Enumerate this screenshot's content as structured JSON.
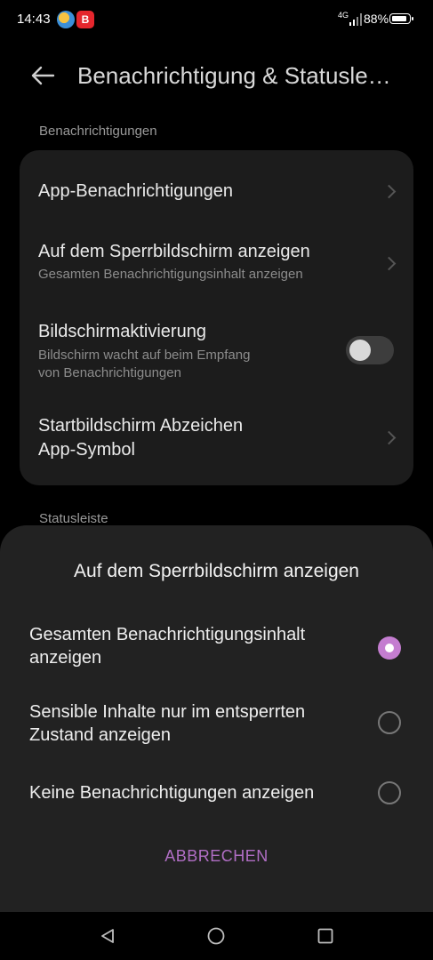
{
  "status_bar": {
    "time": "14:43",
    "network": "4G",
    "battery": "88%",
    "icons": [
      "weather-icon",
      "b-app-icon",
      "signal-icon",
      "battery-icon"
    ]
  },
  "header": {
    "title": "Benachrichtigung & Statusle…",
    "back_icon": "arrow-left-icon"
  },
  "section_notifications": "Benachrichtigungen",
  "settings": [
    {
      "title": "App-Benachrichtigungen",
      "subtitle": ""
    },
    {
      "title": "Auf dem Sperrbildschirm anzeigen",
      "subtitle": "Gesamten Benachrichtigungsinhalt anzeigen"
    },
    {
      "title": "Bildschirmaktivierung",
      "subtitle_line1": "Bildschirm wacht auf beim Empfang",
      "subtitle_line2": "von Benachrichtigungen",
      "toggle_on": false
    },
    {
      "title_line1": "Startbildschirm Abzeichen",
      "title_line2": "App-Symbol"
    }
  ],
  "section_statusbar": "Statusleiste",
  "sheet": {
    "title": "Auf dem Sperrbildschirm anzeigen",
    "options": [
      {
        "line1": "Gesamten Benachrichtigungsinhalt",
        "line2": "anzeigen",
        "selected": true
      },
      {
        "line1": "Sensible Inhalte nur im entsperrten",
        "line2": "Zustand anzeigen",
        "selected": false
      },
      {
        "line1": "Keine Benachrichtigungen anzeigen",
        "line2": "",
        "selected": false
      }
    ],
    "cancel_label": "ABBRECHEN"
  },
  "colors": {
    "accent": "#c47dd0",
    "cancel_text": "#b06ec4",
    "card_bg": "#1c1c1c",
    "sheet_bg": "#222222"
  },
  "nav_bar": {
    "icons": [
      "back-triangle-icon",
      "home-circle-icon",
      "recents-square-icon"
    ]
  }
}
